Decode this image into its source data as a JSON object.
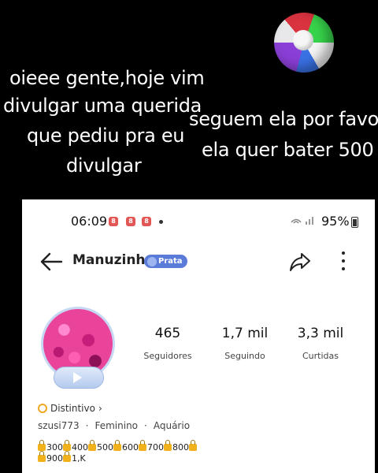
{
  "overlay": {
    "caption_left": [
      "oieee gente,hoje vim",
      "divulgar uma querida",
      "que pediu pra eu",
      "divulgar"
    ],
    "caption_right": [
      "seguem ela por favo",
      "ela quer bater 500"
    ]
  },
  "status_bar": {
    "time": "06:09",
    "notification_icons": [
      "8",
      "8",
      "8"
    ],
    "battery": "95%"
  },
  "profile": {
    "username": "Manuzinha",
    "badge": "Prata",
    "stats": [
      {
        "value": "465",
        "label": "Seguidores"
      },
      {
        "value": "1,7 mil",
        "label": "Seguindo"
      },
      {
        "value": "3,3 mil",
        "label": "Curtidas"
      }
    ],
    "distintivo": "Distintivo",
    "meta": [
      "szusi773",
      "·",
      "Feminino",
      "·",
      "Aquário"
    ],
    "milestones": [
      "300",
      "400",
      "500",
      "600",
      "700",
      "800",
      "900",
      "1,K"
    ]
  },
  "icons": {
    "back": "arrow-left-icon",
    "share": "share-icon",
    "more": "more-vertical-icon"
  }
}
